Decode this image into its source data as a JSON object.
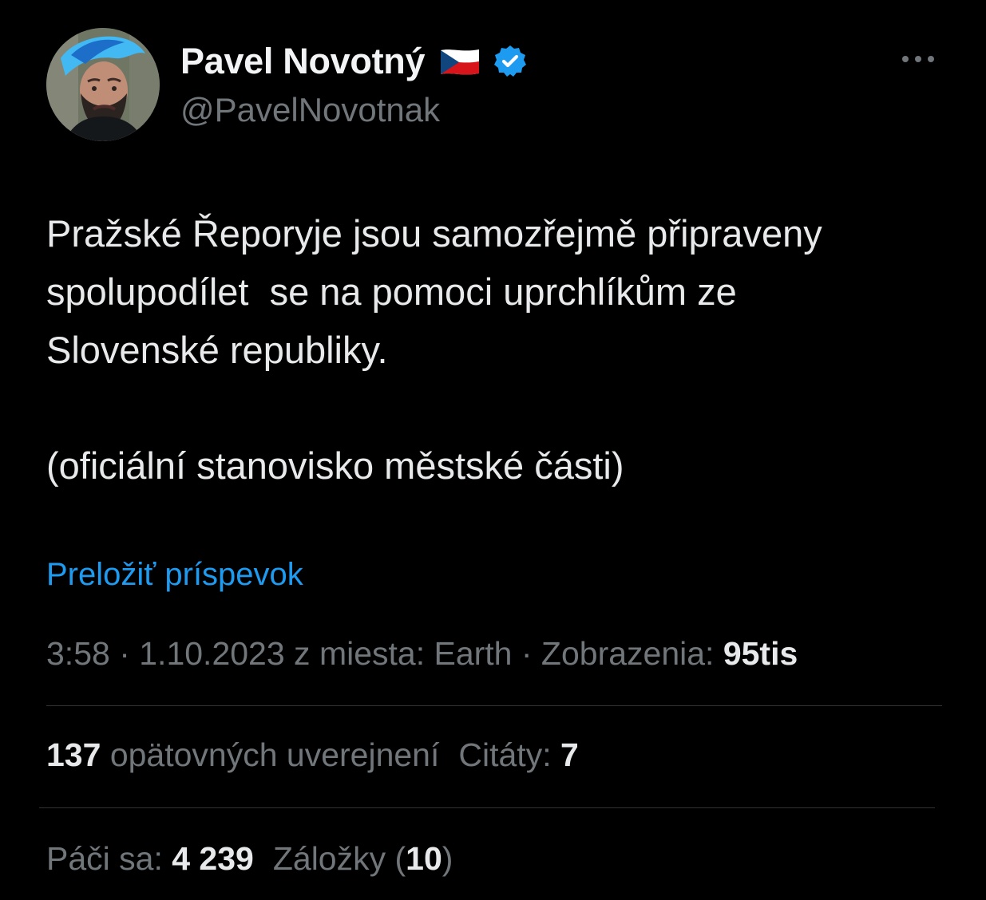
{
  "profile": {
    "display_name": "Pavel Novotný",
    "flag_icon": "czech-flag-icon",
    "verified_icon": "verified-badge-icon",
    "handle": "@PavelNovotnak",
    "avatar_icon": "profile-avatar",
    "more_icon": "more-horizontal-icon"
  },
  "tweet": {
    "line1": "Pražské Řeporyje jsou samozřejmě připraveny",
    "line2": "spolupodílet  se na pomoci uprchlíkům ze",
    "line3": "Slovenské republiky.",
    "line4": "(oficiální stanovisko městské části)"
  },
  "translate": {
    "label": "Preložiť príspevok"
  },
  "meta": {
    "time": "3:58",
    "separator": " · ",
    "date": "1.10.2023",
    "location_label": " z miesta: Earth",
    "views_label": "Zobrazenia: ",
    "views_value": "95tis"
  },
  "stats": {
    "reposts_value": "137",
    "reposts_label": " opätovných uverejnení",
    "quotes_label": "Citáty: ",
    "quotes_value": "7",
    "likes_label": "Páči sa: ",
    "likes_value": "4 239",
    "bookmarks_label": "Záložky (",
    "bookmarks_value": "10",
    "bookmarks_close": ")"
  },
  "colors": {
    "background": "#000000",
    "primary_text": "#e7e9ea",
    "secondary_text": "#71767b",
    "link": "#1d9bf0",
    "verified": "#1d9bf0",
    "divider": "#2f3336"
  }
}
